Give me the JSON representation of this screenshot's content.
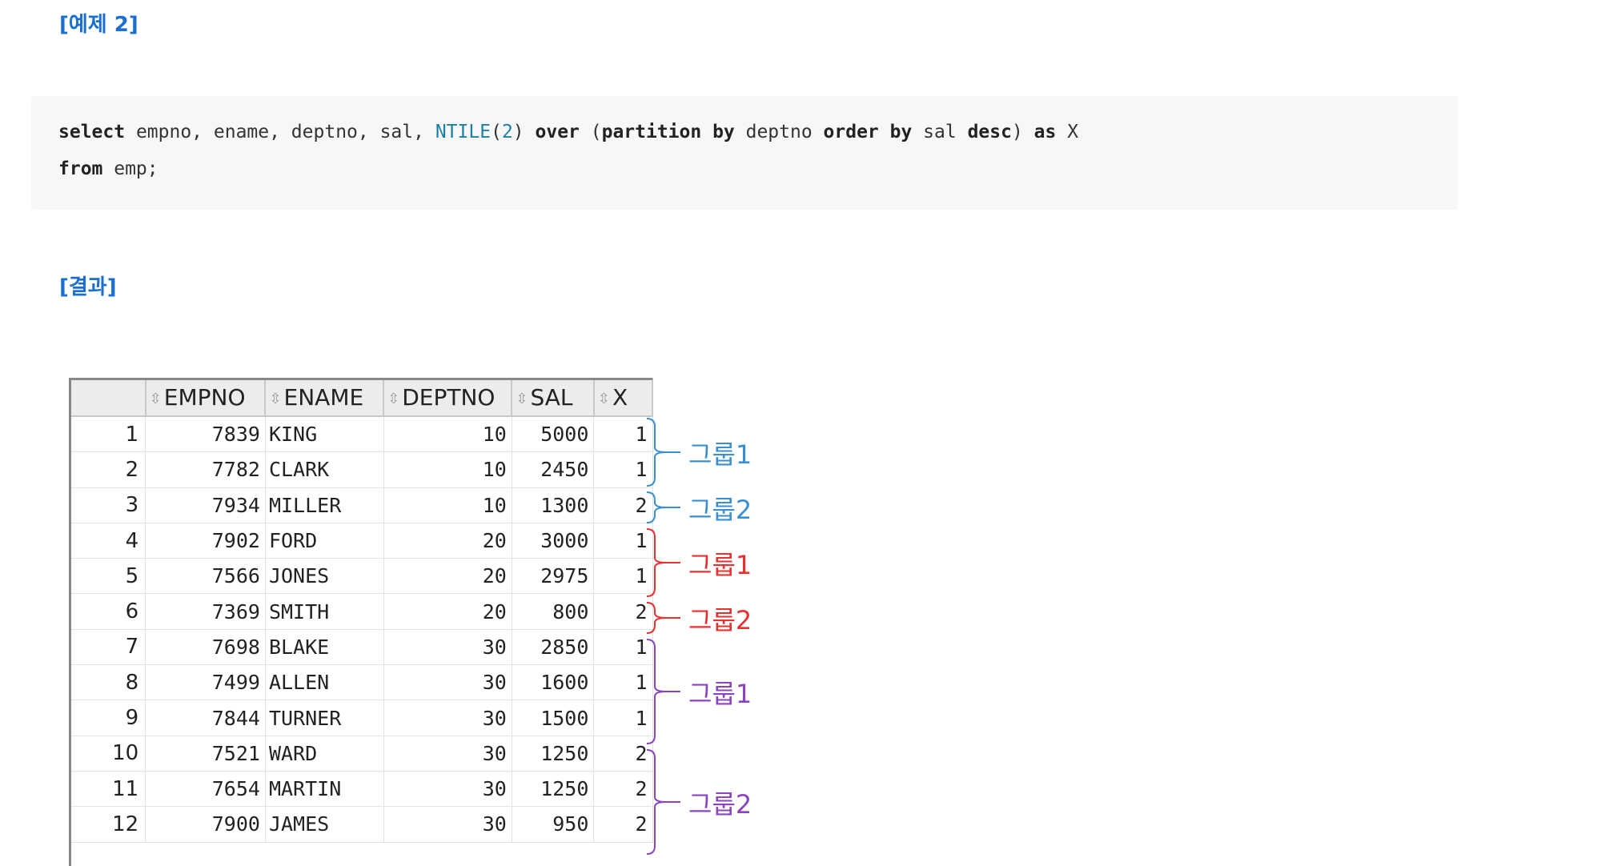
{
  "headings": {
    "example": "[예제 2]",
    "result": "[결과]"
  },
  "code": {
    "line1": [
      {
        "t": "select",
        "c": "kw"
      },
      {
        "t": " empno, ename, deptno, sal, ",
        "c": ""
      },
      {
        "t": "NTILE",
        "c": "fn"
      },
      {
        "t": "(",
        "c": ""
      },
      {
        "t": "2",
        "c": "num"
      },
      {
        "t": ") ",
        "c": ""
      },
      {
        "t": "over",
        "c": "kw"
      },
      {
        "t": " (",
        "c": ""
      },
      {
        "t": "partition by",
        "c": "kw"
      },
      {
        "t": " deptno ",
        "c": ""
      },
      {
        "t": "order by",
        "c": "kw"
      },
      {
        "t": " sal ",
        "c": ""
      },
      {
        "t": "desc",
        "c": "kw"
      },
      {
        "t": ") ",
        "c": ""
      },
      {
        "t": "as",
        "c": "kw"
      },
      {
        "t": " X",
        "c": ""
      }
    ],
    "line2": [
      {
        "t": "from",
        "c": "kw"
      },
      {
        "t": " emp;",
        "c": ""
      }
    ]
  },
  "table": {
    "columns": [
      "EMPNO",
      "ENAME",
      "DEPTNO",
      "SAL",
      "X"
    ],
    "sort_icon": "sort-arrows-icon",
    "rows": [
      {
        "n": "1",
        "empno": "7839",
        "ename": "KING",
        "deptno": "10",
        "sal": "5000",
        "x": "1"
      },
      {
        "n": "2",
        "empno": "7782",
        "ename": "CLARK",
        "deptno": "10",
        "sal": "2450",
        "x": "1"
      },
      {
        "n": "3",
        "empno": "7934",
        "ename": "MILLER",
        "deptno": "10",
        "sal": "1300",
        "x": "2"
      },
      {
        "n": "4",
        "empno": "7902",
        "ename": "FORD",
        "deptno": "20",
        "sal": "3000",
        "x": "1"
      },
      {
        "n": "5",
        "empno": "7566",
        "ename": "JONES",
        "deptno": "20",
        "sal": "2975",
        "x": "1"
      },
      {
        "n": "6",
        "empno": "7369",
        "ename": "SMITH",
        "deptno": "20",
        "sal": "800",
        "x": "2"
      },
      {
        "n": "7",
        "empno": "7698",
        "ename": "BLAKE",
        "deptno": "30",
        "sal": "2850",
        "x": "1"
      },
      {
        "n": "8",
        "empno": "7499",
        "ename": "ALLEN",
        "deptno": "30",
        "sal": "1600",
        "x": "1"
      },
      {
        "n": "9",
        "empno": "7844",
        "ename": "TURNER",
        "deptno": "30",
        "sal": "1500",
        "x": "1"
      },
      {
        "n": "10",
        "empno": "7521",
        "ename": "WARD",
        "deptno": "30",
        "sal": "1250",
        "x": "2"
      },
      {
        "n": "11",
        "empno": "7654",
        "ename": "MARTIN",
        "deptno": "30",
        "sal": "1250",
        "x": "2"
      },
      {
        "n": "12",
        "empno": "7900",
        "ename": "JAMES",
        "deptno": "30",
        "sal": "950",
        "x": "2"
      }
    ]
  },
  "annotations": {
    "colors": {
      "dept10": "#3a8fd0",
      "dept20": "#e83030",
      "dept30": "#8a44c0"
    },
    "groups": [
      {
        "label": "그룹1",
        "dept": "dept10",
        "from": 1,
        "to": 2
      },
      {
        "label": "그룹2",
        "dept": "dept10",
        "from": 3,
        "to": 3
      },
      {
        "label": "그룹1",
        "dept": "dept20",
        "from": 4,
        "to": 5
      },
      {
        "label": "그룹2",
        "dept": "dept20",
        "from": 6,
        "to": 6
      },
      {
        "label": "그룹1",
        "dept": "dept30",
        "from": 7,
        "to": 9
      },
      {
        "label": "그룹2",
        "dept": "dept30",
        "from": 10,
        "to": 12
      }
    ]
  }
}
